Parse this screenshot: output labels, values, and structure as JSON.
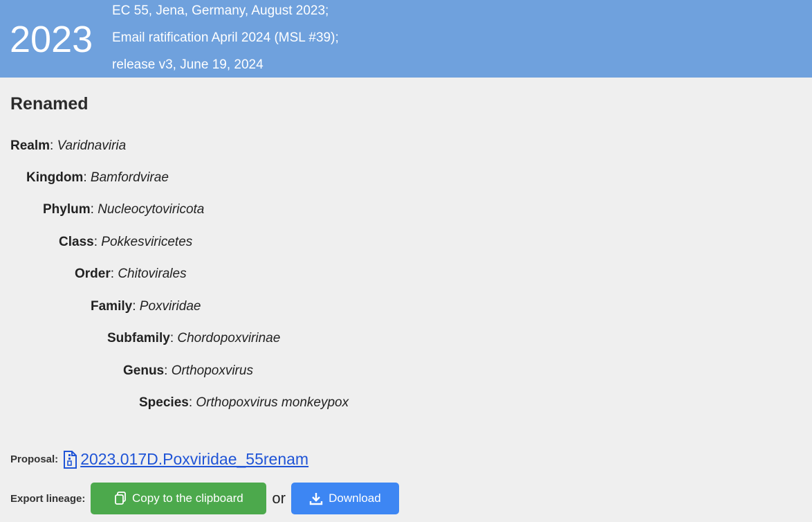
{
  "header": {
    "year": "2023",
    "meta_lines": [
      "EC 55, Jena, Germany, August 2023;",
      "Email ratification April 2024 (MSL #39);",
      "release v3, June 19, 2024"
    ]
  },
  "section_title": "Renamed",
  "lineage": [
    {
      "rank": "Realm",
      "value": "Varidnaviria"
    },
    {
      "rank": "Kingdom",
      "value": "Bamfordvirae"
    },
    {
      "rank": "Phylum",
      "value": "Nucleocytoviricota"
    },
    {
      "rank": "Class",
      "value": "Pokkesviricetes"
    },
    {
      "rank": "Order",
      "value": "Chitovirales"
    },
    {
      "rank": "Family",
      "value": "Poxviridae"
    },
    {
      "rank": "Subfamily",
      "value": "Chordopoxvirinae"
    },
    {
      "rank": "Genus",
      "value": "Orthopoxvirus"
    },
    {
      "rank": "Species",
      "value": "Orthopoxvirus monkeypox"
    }
  ],
  "proposal": {
    "label": "Proposal:",
    "link_text": "2023.017D.Poxviridae_55renam",
    "icon": "file-zip-icon"
  },
  "export": {
    "label": "Export lineage:",
    "copy_label": "Copy to the clipboard",
    "copy_icon": "clipboard-icon",
    "or_text": "or",
    "download_label": "Download",
    "download_icon": "download-icon"
  },
  "colors": {
    "header_bg": "#6fa1dd",
    "page_bg": "#efefef",
    "link": "#1f54d6",
    "copy_button": "#4ca94c",
    "download_button": "#3d86f3"
  }
}
